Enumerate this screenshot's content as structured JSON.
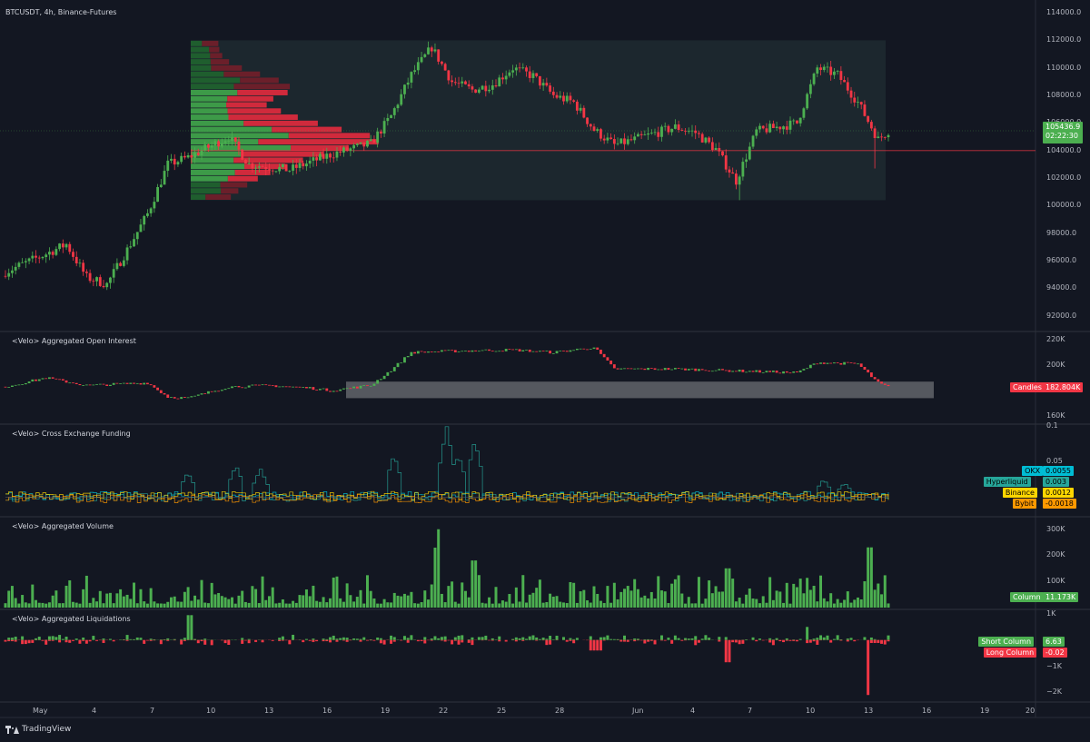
{
  "header": {
    "title": "BTCUSDT, 4h, Binance-Futures"
  },
  "branding": {
    "label": "TradingView"
  },
  "colors": {
    "bg": "#131722",
    "up": "#4caf50",
    "down": "#f23645",
    "grid": "#2a2e39",
    "axis_text": "#b2b5be"
  },
  "x_axis": {
    "labels": [
      "May",
      "4",
      "7",
      "10",
      "13",
      "16",
      "19",
      "22",
      "25",
      "28",
      "Jun",
      "4",
      "7",
      "10",
      "13",
      "16",
      "19",
      "20"
    ]
  },
  "price_pane": {
    "y_ticks": [
      "114000.0",
      "112000.0",
      "110000.0",
      "108000.0",
      "106000.0",
      "104000.0",
      "102000.0",
      "100000.0",
      "98000.0",
      "96000.0",
      "94000.0",
      "92000.0"
    ],
    "last_price": "105436.9",
    "countdown": "02:22:30"
  },
  "oi_pane": {
    "title": "<Velo> Aggregated Open Interest",
    "y_ticks": [
      "220K",
      "200K",
      "160K"
    ],
    "tag_name": "Candles",
    "tag_value": "182.804K"
  },
  "funding_pane": {
    "title": "<Velo> Cross Exchange Funding",
    "y_ticks": [
      "0.1",
      "0.05"
    ],
    "tags": [
      {
        "name": "OKX",
        "value": "0.0055",
        "color": "#00bcd4"
      },
      {
        "name": "Hyperliquid",
        "value": "0.003",
        "color": "#26a69a"
      },
      {
        "name": "Binance",
        "value": "0.0012",
        "color": "#ffd600"
      },
      {
        "name": "Bybit",
        "value": "-0.0018",
        "color": "#ff9800"
      }
    ]
  },
  "volume_pane": {
    "title": "<Velo> Aggregated Volume",
    "y_ticks": [
      "300K",
      "200K",
      "100K"
    ],
    "tag_name": "Column",
    "tag_value": "11.173K"
  },
  "liq_pane": {
    "title": "<Velo> Aggregated Liquidations",
    "y_ticks": [
      "1K",
      "−1K",
      "−2K"
    ],
    "tags": [
      {
        "name": "Short Column",
        "value": "6.63",
        "color": "#4caf50"
      },
      {
        "name": "Long Column",
        "value": "-0.02",
        "color": "#f23645"
      }
    ]
  },
  "chart_data": {
    "type": "candlestick",
    "symbol": "BTCUSDT",
    "interval": "4h",
    "exchange": "Binance-Futures",
    "price_ylim": [
      91000,
      114600
    ],
    "close_anchors": [
      {
        "date": "May 1",
        "price": 95200
      },
      {
        "date": "May 3",
        "price": 96500
      },
      {
        "date": "May 4",
        "price": 97200
      },
      {
        "date": "May 5",
        "price": 94800
      },
      {
        "date": "May 6",
        "price": 94300
      },
      {
        "date": "May 7",
        "price": 96800
      },
      {
        "date": "May 8",
        "price": 99400
      },
      {
        "date": "May 9",
        "price": 103000
      },
      {
        "date": "May 10",
        "price": 103500
      },
      {
        "date": "May 12",
        "price": 105000
      },
      {
        "date": "May 13",
        "price": 103000
      },
      {
        "date": "May 15",
        "price": 102600
      },
      {
        "date": "May 17",
        "price": 103700
      },
      {
        "date": "May 19",
        "price": 104500
      },
      {
        "date": "May 20",
        "price": 106500
      },
      {
        "date": "May 21",
        "price": 109500
      },
      {
        "date": "May 22",
        "price": 111500
      },
      {
        "date": "May 23",
        "price": 109000
      },
      {
        "date": "May 24",
        "price": 108400
      },
      {
        "date": "May 25",
        "price": 108800
      },
      {
        "date": "May 26",
        "price": 110000
      },
      {
        "date": "May 27",
        "price": 109400
      },
      {
        "date": "May 28",
        "price": 108000
      },
      {
        "date": "May 29",
        "price": 107500
      },
      {
        "date": "May 30",
        "price": 105500
      },
      {
        "date": "May 31",
        "price": 104400
      },
      {
        "date": "Jun 1",
        "price": 104800
      },
      {
        "date": "Jun 3",
        "price": 105700
      },
      {
        "date": "Jun 4",
        "price": 105300
      },
      {
        "date": "Jun 5",
        "price": 104100
      },
      {
        "date": "Jun 6",
        "price": 101800
      },
      {
        "date": "Jun 7",
        "price": 105400
      },
      {
        "date": "Jun 9",
        "price": 106000
      },
      {
        "date": "Jun 10",
        "price": 110000
      },
      {
        "date": "Jun 11",
        "price": 109500
      },
      {
        "date": "Jun 12",
        "price": 107500
      },
      {
        "date": "Jun 13",
        "price": 104800
      },
      {
        "date": "Jun 13",
        "price": 105436.9
      }
    ],
    "open_interest_ylim": [
      155000,
      225000
    ],
    "open_interest_anchors": [
      {
        "date": "May 1",
        "value": 183000
      },
      {
        "date": "May 3",
        "value": 190000
      },
      {
        "date": "May 5",
        "value": 184000
      },
      {
        "date": "May 8",
        "value": 186000
      },
      {
        "date": "May 9",
        "value": 175000
      },
      {
        "date": "May 10",
        "value": 174000
      },
      {
        "date": "May 12",
        "value": 183000
      },
      {
        "date": "May 14",
        "value": 184000
      },
      {
        "date": "May 16",
        "value": 182000
      },
      {
        "date": "May 17",
        "value": 180000
      },
      {
        "date": "May 19",
        "value": 184000
      },
      {
        "date": "May 20",
        "value": 196000
      },
      {
        "date": "May 21",
        "value": 210000
      },
      {
        "date": "May 23",
        "value": 211000
      },
      {
        "date": "May 26",
        "value": 212000
      },
      {
        "date": "May 28",
        "value": 210000
      },
      {
        "date": "May 30",
        "value": 214000
      },
      {
        "date": "May 31",
        "value": 197000
      },
      {
        "date": "Jun 3",
        "value": 197000
      },
      {
        "date": "Jun 7",
        "value": 195000
      },
      {
        "date": "Jun 9",
        "value": 194000
      },
      {
        "date": "Jun 10",
        "value": 202000
      },
      {
        "date": "Jun 12",
        "value": 201000
      },
      {
        "date": "Jun 13",
        "value": 186000
      },
      {
        "date": "Jun 13",
        "value": 182804
      }
    ],
    "funding_ylim": [
      -0.025,
      0.1
    ],
    "volume_ylim": [
      0,
      340000
    ],
    "liquidations_ylim": [
      -2300,
      1100
    ],
    "volume_profile_range": [
      100400,
      112000
    ],
    "point_of_control": 104000
  }
}
